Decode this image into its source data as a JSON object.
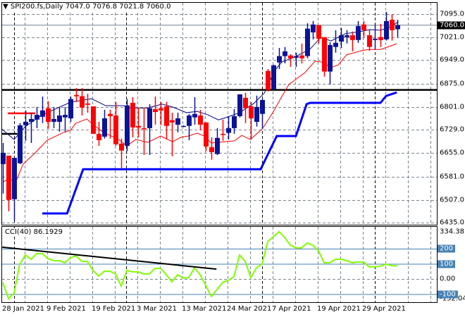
{
  "header": {
    "arrow_icon": "triangle-down-icon",
    "symbol": "SPI200.fs,Daily",
    "open": "7047.0",
    "high": "7076.8",
    "low": "7021.8",
    "close": "7060.0"
  },
  "cci_title": "CCI(40) 86.1929",
  "colors": {
    "bull": "#0a1496",
    "bear": "#ff0000",
    "ma_fast": "#000080",
    "ma_slow": "#ff0000",
    "support": "#0000ff",
    "cci": "#80ff00",
    "levels": "#4682b4",
    "grid": "#7a8590"
  },
  "price_axis": {
    "labels": [
      "7095.0",
      "7021.0",
      "6949.0",
      "6875.0",
      "6801.0",
      "6729.0",
      "6655.0",
      "6581.0",
      "6507.0",
      "6435.0"
    ],
    "current": "7060.0"
  },
  "cci_axis": {
    "max": "334.3816",
    "min": "-152.042",
    "zero": "0.00",
    "levels": [
      "200",
      "100",
      "-100"
    ]
  },
  "x_axis": {
    "labels": [
      "28 Jan 2021",
      "9 Feb 2021",
      "19 Feb 2021",
      "3 Mar 2021",
      "13 Mar 2021",
      "24 Mar 2021",
      "7 Apr 2021",
      "19 Apr 2021",
      "29 Apr 2021"
    ]
  },
  "chart_data": [
    {
      "type": "candlestick",
      "title": "SPI200.fs,Daily",
      "ylim": [
        6435,
        7095
      ],
      "ohlc": [
        [
          6620,
          6687,
          6527,
          6656
        ],
        [
          6647,
          6647,
          6471,
          6507
        ],
        [
          6509,
          6640,
          6442,
          6640
        ],
        [
          6623,
          6750,
          6620,
          6743
        ],
        [
          6743,
          6790,
          6694,
          6754
        ],
        [
          6754,
          6783,
          6687,
          6763
        ],
        [
          6761,
          6801,
          6734,
          6776
        ],
        [
          6770,
          6834,
          6750,
          6790
        ],
        [
          6797,
          6819,
          6732,
          6754
        ],
        [
          6754,
          6801,
          6734,
          6763
        ],
        [
          6754,
          6801,
          6723,
          6774
        ],
        [
          6768,
          6801,
          6723,
          6776
        ],
        [
          6765,
          6834,
          6754,
          6826
        ],
        [
          6839,
          6861,
          6817,
          6835
        ],
        [
          6835,
          6861,
          6774,
          6799
        ],
        [
          6812,
          6843,
          6783,
          6808
        ],
        [
          6803,
          6803,
          6716,
          6716
        ],
        [
          6716,
          6754,
          6678,
          6696
        ],
        [
          6707,
          6792,
          6701,
          6765
        ],
        [
          6779,
          6792,
          6701,
          6772
        ],
        [
          6774,
          6817,
          6678,
          6683
        ],
        [
          6685,
          6701,
          6605,
          6663
        ],
        [
          6678,
          6826,
          6661,
          6806
        ],
        [
          6814,
          6832,
          6705,
          6736
        ],
        [
          6741,
          6799,
          6705,
          6736
        ],
        [
          6734,
          6799,
          6649,
          6732
        ],
        [
          6734,
          6810,
          6649,
          6797
        ],
        [
          6794,
          6834,
          6745,
          6785
        ],
        [
          6797,
          6817,
          6743,
          6790
        ],
        [
          6803,
          6817,
          6698,
          6741
        ],
        [
          6759,
          6783,
          6645,
          6752
        ],
        [
          6745,
          6783,
          6721,
          6765
        ],
        [
          6741,
          6743,
          6739,
          6741
        ],
        [
          6741,
          6779,
          6696,
          6774
        ],
        [
          6768,
          6832,
          6745,
          6779
        ],
        [
          6774,
          6792,
          6727,
          6745
        ],
        [
          6752,
          6752,
          6661,
          6676
        ],
        [
          6674,
          6705,
          6634,
          6658
        ],
        [
          6652,
          6734,
          6649,
          6703
        ],
        [
          6716,
          6761,
          6694,
          6714
        ],
        [
          6719,
          6772,
          6698,
          6734
        ],
        [
          6734,
          6794,
          6716,
          6772
        ],
        [
          6772,
          6841,
          6768,
          6841
        ],
        [
          6830,
          6846,
          6750,
          6797
        ],
        [
          6803,
          6817,
          6698,
          6765
        ],
        [
          6754,
          6837,
          6739,
          6801
        ],
        [
          6779,
          6828,
          6732,
          6823
        ],
        [
          6915,
          6921,
          6850,
          6855
        ],
        [
          6857,
          6935,
          6855,
          6933
        ],
        [
          6942,
          6988,
          6921,
          6962
        ],
        [
          6962,
          6991,
          6939,
          6977
        ],
        [
          6964,
          6968,
          6928,
          6955
        ],
        [
          6957,
          6973,
          6928,
          6962
        ],
        [
          6964,
          7002,
          6939,
          6955
        ],
        [
          6962,
          7066,
          6955,
          7049
        ],
        [
          7037,
          7073,
          7015,
          7062
        ],
        [
          7060,
          7060,
          7002,
          7017
        ],
        [
          7022,
          7022,
          6897,
          6913
        ],
        [
          6913,
          7006,
          6872,
          6997
        ],
        [
          6991,
          7044,
          6973,
          7004
        ],
        [
          7008,
          7051,
          6988,
          7028
        ],
        [
          7022,
          7044,
          7002,
          7028
        ],
        [
          7028,
          7040,
          6977,
          7013
        ],
        [
          7013,
          7073,
          7004,
          7057
        ],
        [
          7062,
          7073,
          7022,
          7044
        ],
        [
          7028,
          7044,
          6979,
          6991
        ],
        [
          7013,
          7062,
          6984,
          7017
        ],
        [
          7022,
          7064,
          6991,
          7013
        ],
        [
          7015,
          7102,
          7011,
          7073
        ],
        [
          7077,
          7095,
          7011,
          7044
        ],
        [
          7047,
          7077,
          7022,
          7060
        ]
      ],
      "ma_fast": [
        [
          -0.25,
          6732
        ],
        [
          2,
          6698
        ],
        [
          3.9,
          6738
        ],
        [
          7,
          6776
        ],
        [
          12,
          6816
        ],
        [
          15.75,
          6827
        ],
        [
          18.25,
          6805
        ],
        [
          21.4,
          6805
        ],
        [
          22.6,
          6798
        ],
        [
          25.75,
          6798
        ],
        [
          28.25,
          6810
        ],
        [
          30.1,
          6801
        ],
        [
          32.6,
          6783
        ],
        [
          34.5,
          6787
        ],
        [
          36.4,
          6776
        ],
        [
          38.25,
          6760
        ],
        [
          39.5,
          6767
        ],
        [
          42,
          6783
        ],
        [
          44.5,
          6812
        ],
        [
          46.4,
          6845
        ],
        [
          48.25,
          6917
        ],
        [
          49.5,
          6943
        ],
        [
          52,
          6961
        ],
        [
          54.5,
          6984
        ],
        [
          56.4,
          7021
        ],
        [
          58.25,
          7010
        ],
        [
          60.75,
          7033
        ],
        [
          63.25,
          7039
        ],
        [
          65.1,
          7046
        ],
        [
          67,
          7044
        ],
        [
          68.9,
          7055
        ],
        [
          70.1,
          7070
        ]
      ],
      "ma_slow": [
        [
          0.1,
          6564
        ],
        [
          1.1,
          6575
        ],
        [
          2.25,
          6562
        ],
        [
          3.6,
          6620
        ],
        [
          5.75,
          6656
        ],
        [
          7.9,
          6696
        ],
        [
          10.75,
          6720
        ],
        [
          12,
          6727
        ],
        [
          12.9,
          6749
        ],
        [
          14.9,
          6763
        ],
        [
          15.75,
          6749
        ],
        [
          17.9,
          6720
        ],
        [
          20.4,
          6700
        ],
        [
          22,
          6678
        ],
        [
          23.6,
          6698
        ],
        [
          25.75,
          6689
        ],
        [
          28,
          6709
        ],
        [
          30.1,
          6691
        ],
        [
          31.6,
          6705
        ],
        [
          32.9,
          6709
        ],
        [
          34.5,
          6718
        ],
        [
          35.75,
          6709
        ],
        [
          37,
          6687
        ],
        [
          41.1,
          6694
        ],
        [
          42.4,
          6711
        ],
        [
          43.9,
          6698
        ],
        [
          46,
          6731
        ],
        [
          47.9,
          6783
        ],
        [
          49.5,
          6834
        ],
        [
          50.75,
          6872
        ],
        [
          53.6,
          6910
        ],
        [
          55.4,
          6946
        ],
        [
          56.6,
          6943
        ],
        [
          58.25,
          6926
        ],
        [
          59.5,
          6934
        ],
        [
          61,
          6966
        ],
        [
          63.6,
          6979
        ],
        [
          64.9,
          6983
        ],
        [
          67,
          6983
        ],
        [
          69.9,
          7001
        ]
      ],
      "support_line": [
        [
          7,
          6464
        ],
        [
          11.4,
          6464
        ],
        [
          14.25,
          6604
        ],
        [
          45.75,
          6604
        ],
        [
          48.6,
          6709
        ],
        [
          52,
          6709
        ],
        [
          53.9,
          6810
        ],
        [
          54.5,
          6814
        ],
        [
          67,
          6814
        ],
        [
          68,
          6836
        ],
        [
          69.9,
          6847
        ]
      ],
      "horizontal_levels": [
        {
          "price": 6855,
          "color": "#000000",
          "from": -1,
          "to": 78
        },
        {
          "price": 6716,
          "color": "#000000",
          "from": -1,
          "to": 2.6
        },
        {
          "price": 6781,
          "color": "#ff0000",
          "from": 0.9,
          "to": 5.75
        }
      ]
    },
    {
      "type": "line",
      "title": "CCI(40)",
      "ylim": [
        -152.042,
        334.3816
      ],
      "levels": [
        200,
        100,
        0,
        -100
      ],
      "values": [
        -23,
        -130,
        -93,
        98,
        158,
        130,
        167,
        167,
        135,
        121,
        121,
        107,
        140,
        153,
        116,
        116,
        56,
        19,
        51,
        51,
        33,
        -47,
        56,
        47,
        47,
        33,
        33,
        70,
        70,
        28,
        -19,
        28,
        5,
        9,
        74,
        28,
        -42,
        -116,
        -70,
        -23,
        -9,
        14,
        158,
        116,
        9,
        74,
        98,
        247,
        279,
        312,
        274,
        223,
        205,
        205,
        237,
        223,
        186,
        107,
        107,
        130,
        130,
        121,
        107,
        112,
        112,
        79,
        81,
        84,
        98,
        88,
        86.19
      ],
      "trendline": [
        [
          -0.1,
          210
        ],
        [
          37.9,
          65
        ]
      ]
    }
  ]
}
